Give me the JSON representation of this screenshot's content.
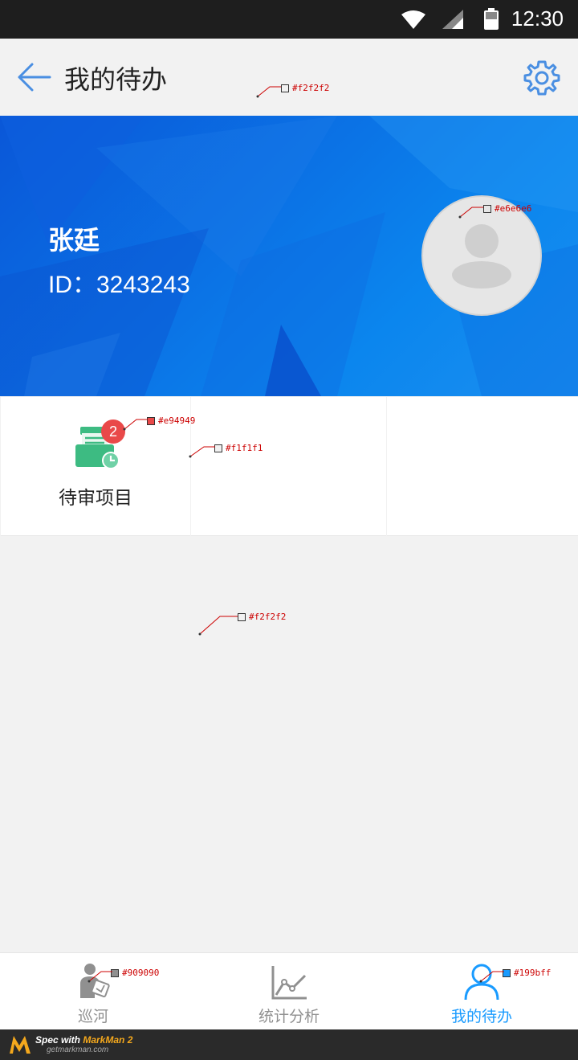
{
  "status_bar": {
    "time": "12:30"
  },
  "header": {
    "title": "我的待办",
    "back_icon": "back-arrow-icon",
    "settings_icon": "gear-icon",
    "accent": "#4a8fe2"
  },
  "profile": {
    "name": "张廷",
    "id_label": "ID：",
    "id_value": "3243243",
    "avatar_icon": "user-avatar-icon"
  },
  "tiles": [
    {
      "label": "待审项目",
      "badge": "2",
      "icon": "document-clock-icon",
      "icon_color": "#3dbb82"
    },
    {
      "label": ""
    },
    {
      "label": ""
    }
  ],
  "annotations": {
    "header_bg": "#f2f2f2",
    "avatar_bg": "#e6e6e6",
    "badge_bg": "#e94949",
    "tile_border": "#f1f1f1",
    "page_bg": "#f2f2f2",
    "nav_inactive": "#909090",
    "nav_active": "#199bff"
  },
  "bottom_nav": [
    {
      "label": "巡河",
      "icon": "patrol-person-icon",
      "active": false
    },
    {
      "label": "统计分析",
      "icon": "line-chart-icon",
      "active": false
    },
    {
      "label": "我的待办",
      "icon": "person-outline-icon",
      "active": true
    }
  ],
  "footer": {
    "spec_prefix": "Spec with ",
    "brand": "MarkMan 2",
    "site": "getmarkman.com"
  }
}
